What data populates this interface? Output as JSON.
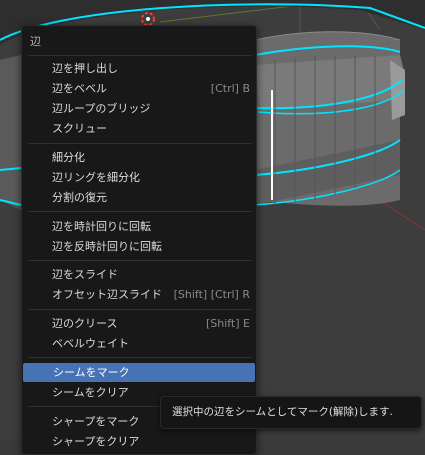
{
  "menu": {
    "title": "辺",
    "items": [
      {
        "label": "辺を押し出し",
        "shortcut": ""
      },
      {
        "label": "辺をベベル",
        "shortcut": "[Ctrl] B"
      },
      {
        "label": "辺ループのブリッジ",
        "shortcut": ""
      },
      {
        "label": "スクリュー",
        "shortcut": ""
      },
      {
        "label": "細分化",
        "shortcut": ""
      },
      {
        "label": "辺リングを細分化",
        "shortcut": ""
      },
      {
        "label": "分割の復元",
        "shortcut": ""
      },
      {
        "label": "辺を時計回りに回転",
        "shortcut": ""
      },
      {
        "label": "辺を反時計回りに回転",
        "shortcut": ""
      },
      {
        "label": "辺をスライド",
        "shortcut": ""
      },
      {
        "label": "オフセット辺スライド",
        "shortcut": "[Shift] [Ctrl] R"
      },
      {
        "label": "辺のクリース",
        "shortcut": "[Shift] E"
      },
      {
        "label": "ベベルウェイト",
        "shortcut": ""
      },
      {
        "label": "シームをマーク",
        "shortcut": ""
      },
      {
        "label": "シームをクリア",
        "shortcut": ""
      },
      {
        "label": "シャープをマーク",
        "shortcut": ""
      },
      {
        "label": "シャープをクリア",
        "shortcut": ""
      }
    ]
  },
  "tooltip": {
    "text": "選択中の辺をシームとしてマーク(解除)します."
  },
  "colors": {
    "selected_edge": "#00e5ff",
    "active_item": "#4772b3",
    "menu_bg": "#181818"
  }
}
